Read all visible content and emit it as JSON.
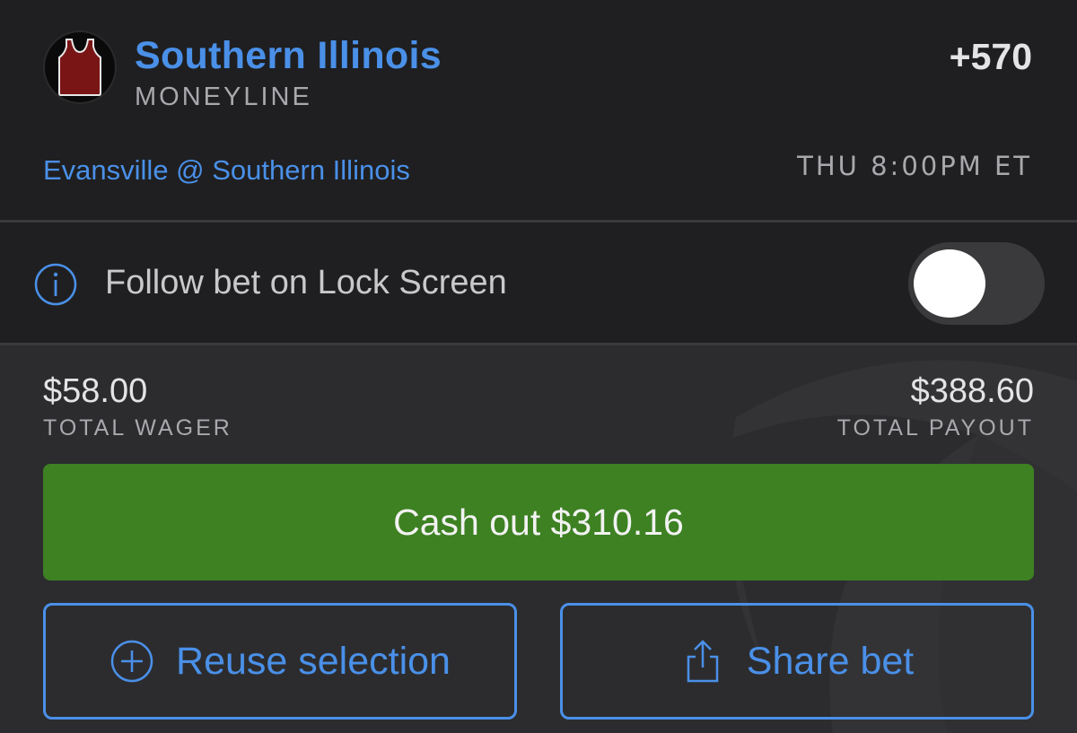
{
  "bet": {
    "team_name": "Southern Illinois",
    "bet_type": "MONEYLINE",
    "odds": "+570",
    "matchup": "Evansville @ Southern Illinois",
    "game_time": "THU 8:00PM ET",
    "team_logo_icon": "basketball-jersey-icon"
  },
  "follow": {
    "label": "Follow bet on Lock Screen",
    "icon": "info-icon",
    "toggle_on": false
  },
  "totals": {
    "wager_amount": "$58.00",
    "wager_label": "TOTAL WAGER",
    "payout_amount": "$388.60",
    "payout_label": "TOTAL PAYOUT"
  },
  "actions": {
    "cashout_label": "Cash out $310.16",
    "reuse_label": "Reuse selection",
    "reuse_icon": "plus-circle-icon",
    "share_label": "Share bet",
    "share_icon": "share-icon"
  },
  "colors": {
    "accent_blue": "#4a90e8",
    "cashout_green": "#3d8122",
    "background_dark": "#1f1f21",
    "background_panel": "#2c2c2f",
    "jersey_maroon": "#7a1515"
  }
}
